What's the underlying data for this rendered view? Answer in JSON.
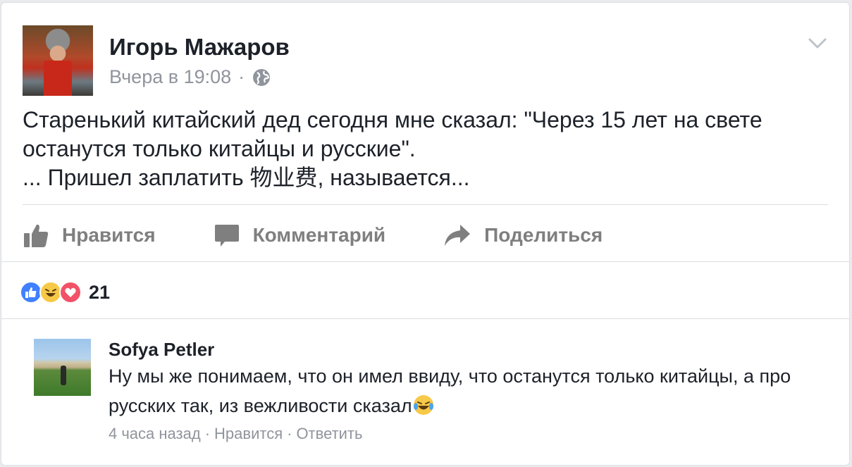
{
  "post": {
    "author": "Игорь Мажаров",
    "timestamp": "Вчера в 19:08",
    "separator": "·",
    "privacy_icon": "globe-icon",
    "text": "Старенький китайский дед  сегодня мне сказал: \"Через 15 лет на свете останутся только китайцы и русские\".\n... Пришел заплатить 物业费, называется..."
  },
  "actions": {
    "like_label": "Нравится",
    "comment_label": "Комментарий",
    "share_label": "Поделиться"
  },
  "reactions": {
    "icons": [
      "like-icon",
      "haha-icon",
      "love-icon"
    ],
    "count": "21",
    "colors": {
      "like": "#4080ff",
      "haha": "#f7c948",
      "love": "#f25268"
    }
  },
  "comment": {
    "author": "Sofya Petler",
    "text": "Ну мы же понимаем, что он имел ввиду, что останутся только китайцы, а про русских так, из вежливости сказал",
    "emoji": "tears-of-joy-icon",
    "time": "4 часа назад",
    "like_label": "Нравится",
    "reply_label": "Ответить",
    "separator": "·"
  },
  "colors": {
    "text": "#1d2129",
    "meta": "#90949c",
    "action": "#7f7f7f",
    "divider": "#dadde1"
  }
}
